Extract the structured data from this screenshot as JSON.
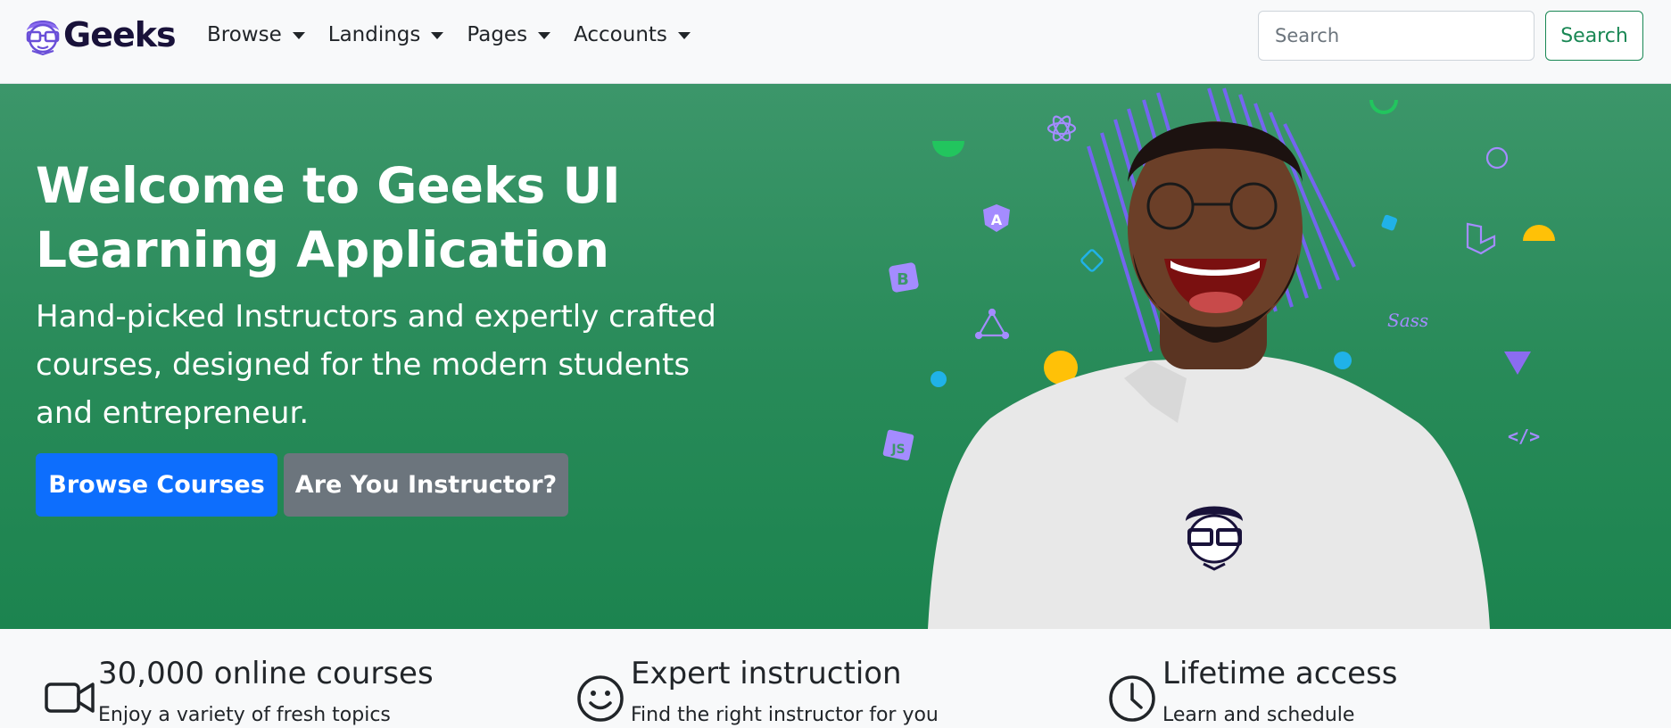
{
  "brand": {
    "name": "Geeks",
    "logo_icon": "geek-face-logo-icon"
  },
  "nav": {
    "items": [
      {
        "label": "Browse"
      },
      {
        "label": "Landings"
      },
      {
        "label": "Pages"
      },
      {
        "label": "Accounts"
      }
    ]
  },
  "search": {
    "placeholder": "Search",
    "value": "",
    "button_label": "Search"
  },
  "hero": {
    "title_line1": "Welcome to Geeks UI",
    "title_line2": "Learning Application",
    "subtitle": "Hand-picked Instructors and expertly crafted courses, designed for the modern students and entrepreneur.",
    "primary_button": "Browse Courses",
    "secondary_button": "Are You Instructor?",
    "image_icon": "smiling-student-illustration"
  },
  "features": [
    {
      "title": "30,000 online courses",
      "text": "Enjoy a variety of fresh topics",
      "icon": "video-camera-icon"
    },
    {
      "title": "Expert instruction",
      "text": "Find the right instructor for you",
      "icon": "smile-icon"
    },
    {
      "title": "Lifetime access",
      "text": "Learn and schedule",
      "icon": "clock-icon"
    }
  ],
  "colors": {
    "hero_green": "#278a58",
    "primary_blue": "#0d6efd",
    "secondary_gray": "#6c757d",
    "search_green": "#198754",
    "brand_navy": "#19123a",
    "accent_purple": "#7b61ff"
  }
}
